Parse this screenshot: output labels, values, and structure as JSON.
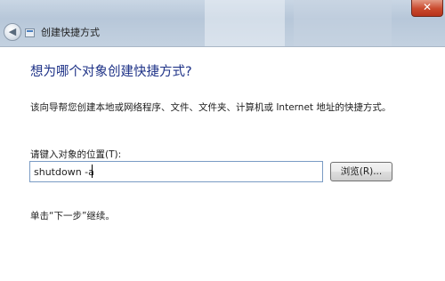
{
  "window": {
    "close_glyph": "✕",
    "back_icon": "back-arrow-icon",
    "title": "创建快捷方式"
  },
  "page": {
    "heading": "想为哪个对象创建快捷方式?",
    "description": "该向导帮您创建本地或网络程序、文件、文件夹、计算机或 Internet 地址的快捷方式。",
    "location_label": "请键入对象的位置(T):",
    "location_value": "shutdown -a",
    "browse_label": "浏览(R)...",
    "hint": "单击“下一步”继续。"
  }
}
